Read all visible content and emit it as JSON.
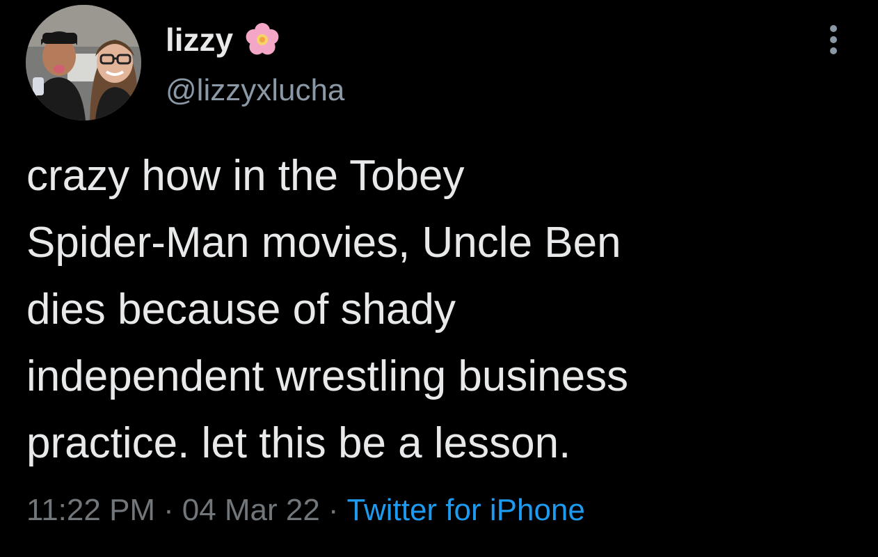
{
  "author": {
    "display_name": "lizzy",
    "name_emoji": "cherry-blossom-icon",
    "handle": "@lizzyxlucha"
  },
  "tweet": {
    "lines": [
      "crazy how in the Tobey",
      "Spider-Man movies, Uncle Ben",
      "dies because of shady",
      "independent wrestling business",
      "practice. let this be a lesson."
    ]
  },
  "meta": {
    "time": "11:22 PM",
    "separator": "·",
    "date": "04 Mar 22",
    "source": "Twitter for iPhone"
  },
  "colors": {
    "background": "#000000",
    "text": "#e7e9ea",
    "secondary": "#71767b",
    "link": "#1d9bf0"
  },
  "icons": {
    "more": "more-dots-icon"
  }
}
